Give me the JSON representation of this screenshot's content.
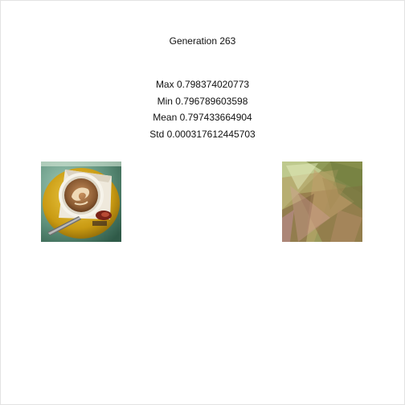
{
  "generation_label": "Generation 263",
  "stats": {
    "max": "Max 0.798374020773",
    "min": "Min 0.796789603598",
    "mean": "Mean 0.797433664904",
    "std": "Std 0.000317612445703"
  },
  "images": {
    "target": {
      "subject": "coffee-cup-photo"
    },
    "best": {
      "subject": "evolved-polygon-approximation"
    }
  },
  "colors": {
    "background": "#ffffff",
    "text": "#111111",
    "window_border": "#e3e3e3"
  }
}
